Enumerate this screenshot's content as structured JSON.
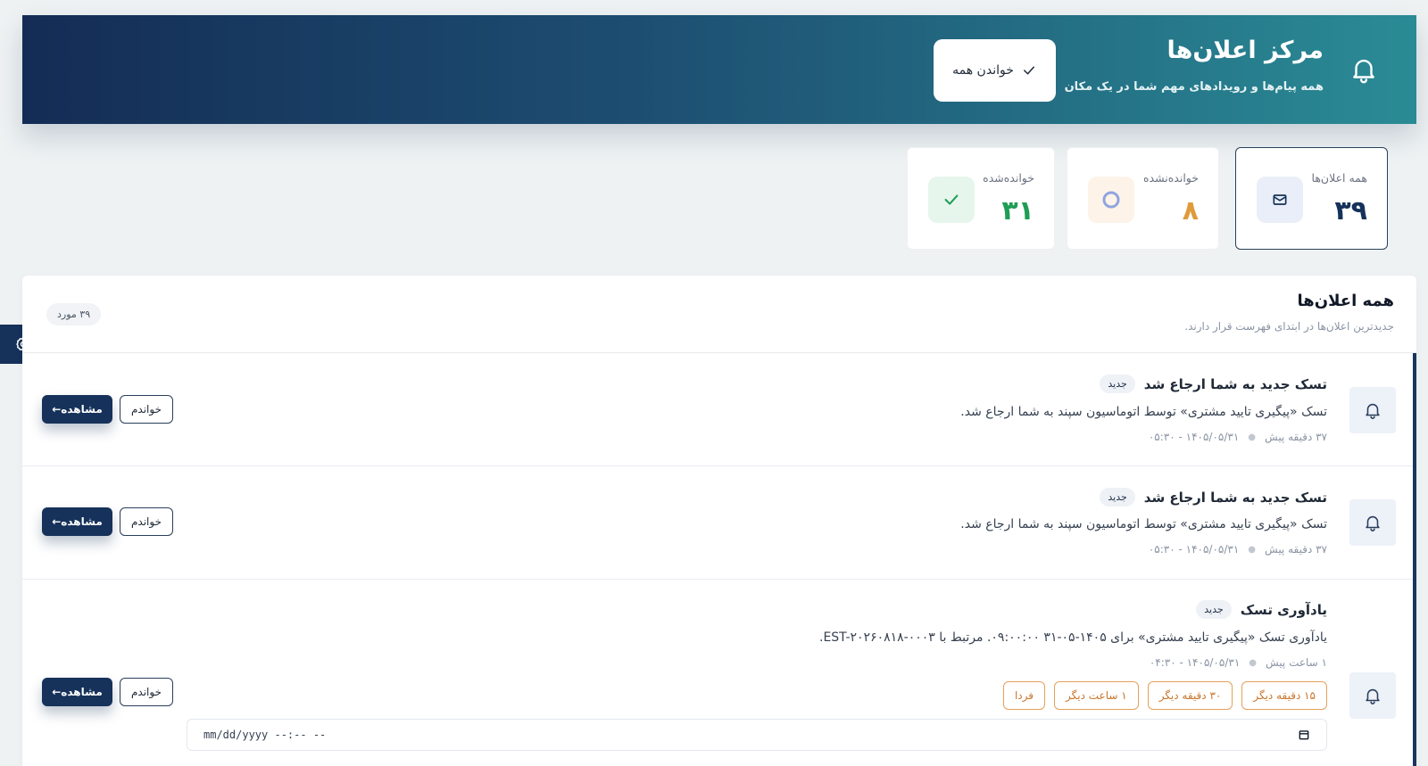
{
  "header": {
    "title": "مرکز اعلان‌ها",
    "subtitle": "همه پیام‌ها و رویدادهای مهم شما در یک مکان",
    "mark_all_label": "خواندن همه"
  },
  "stats": [
    {
      "label": "همه اعلان‌ها",
      "value": "۳۹",
      "icon": "envelope-icon",
      "color": "#16325a",
      "active": true
    },
    {
      "label": "خوانده‌نشده",
      "value": "۸",
      "icon": "circle-icon",
      "color": "#e09a3a"
    },
    {
      "label": "خوانده‌شده",
      "value": "۳۱",
      "icon": "check-icon",
      "color": "#1f9d55"
    }
  ],
  "panel": {
    "title": "همه اعلان‌ها",
    "subtitle": "جدیدترین اعلان‌ها در ابتدای فهرست قرار دارند.",
    "count": "۳۹ مورد"
  },
  "notifications": [
    {
      "title": "تسک جدید به شما ارجاع شد",
      "badge": "جدید",
      "body": "تسک «پیگیری تایید مشتری» توسط اتوماسیون سپند به شما ارجاع شد.",
      "ago": "۳۷ دقیقه پیش",
      "datetime": "۱۴۰۵/۰۵/۳۱ - ۰۵:۳۰",
      "read_label": "خواندم",
      "view_label": "مشاهده←"
    },
    {
      "title": "تسک جدید به شما ارجاع شد",
      "badge": "جدید",
      "body": "تسک «پیگیری تایید مشتری» توسط اتوماسیون سپند به شما ارجاع شد.",
      "ago": "۳۷ دقیقه پیش",
      "datetime": "۱۴۰۵/۰۵/۳۱ - ۰۵:۳۰",
      "read_label": "خواندم",
      "view_label": "مشاهده←"
    },
    {
      "title": "یادآوری تسک",
      "badge": "جدید",
      "body": "یادآوری تسک «پیگیری تایید مشتری» برای ۱۴۰۵-۰۵-۳۱ ۰۹:۰۰:۰۰. مرتبط با EST-۲۰۲۶۰۸۱۸-۰۰۰۳.",
      "ago": "۱ ساعت پیش",
      "datetime": "۱۴۰۵/۰۵/۳۱ - ۰۴:۳۰",
      "read_label": "خواندم",
      "view_label": "مشاهده←",
      "snooze_options": [
        "۱۵ دقیقه دیگر",
        "۳۰ دقیقه دیگر",
        "۱ ساعت دیگر",
        "فردا"
      ],
      "date_placeholder": "mm/dd/yyyy --:-- --"
    }
  ]
}
